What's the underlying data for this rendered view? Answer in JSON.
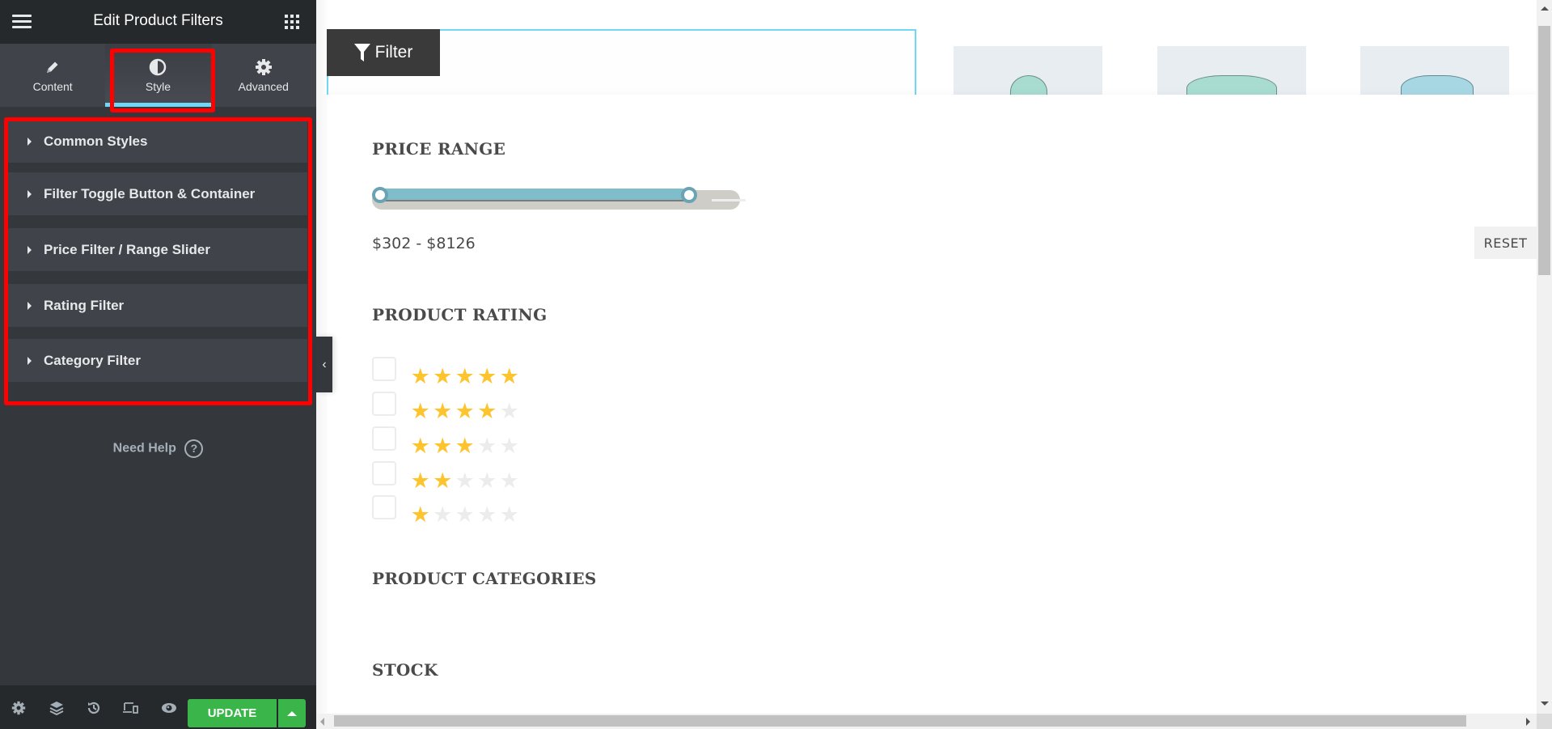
{
  "panel": {
    "title": "Edit Product Filters",
    "tabs": [
      {
        "label": "Content",
        "icon": "pencil-icon",
        "active": false
      },
      {
        "label": "Style",
        "icon": "half-circle-icon",
        "active": true
      },
      {
        "label": "Advanced",
        "icon": "gear-icon",
        "active": false
      }
    ],
    "sections": [
      {
        "label": "Common Styles"
      },
      {
        "label": "Filter Toggle Button & Container"
      },
      {
        "label": "Price Filter / Range Slider"
      },
      {
        "label": "Rating Filter"
      },
      {
        "label": "Category Filter"
      }
    ],
    "need_help": "Need Help",
    "help_icon_glyph": "?",
    "footer": {
      "icons": [
        "settings-icon",
        "layers-icon",
        "history-icon",
        "responsive-icon",
        "preview-eye-icon"
      ],
      "update_label": "UPDATE"
    },
    "collapse_glyph": "‹",
    "accent_color": "#71d7f7",
    "update_color": "#39b54a"
  },
  "preview": {
    "filter_button": "Filter",
    "products": [
      {
        "name": "hat-thumbnail"
      },
      {
        "name": "sweatshirt-thumbnail"
      },
      {
        "name": "shirt-thumbnail"
      }
    ],
    "price_range": {
      "heading": "PRICE RANGE",
      "min_fraction": 0.0,
      "max_fraction": 0.8,
      "text": "$302 - $8126"
    },
    "reset_label": "RESET",
    "rating": {
      "heading": "PRODUCT RATING",
      "rows": [
        {
          "stars": 5,
          "checked": false
        },
        {
          "stars": 4,
          "checked": false
        },
        {
          "stars": 3,
          "checked": false
        },
        {
          "stars": 2,
          "checked": false
        },
        {
          "stars": 1,
          "checked": false
        }
      ],
      "max_stars": 5,
      "star_glyph": "★"
    },
    "categories_heading": "PRODUCT CATEGORIES",
    "stock_heading": "STOCK"
  }
}
